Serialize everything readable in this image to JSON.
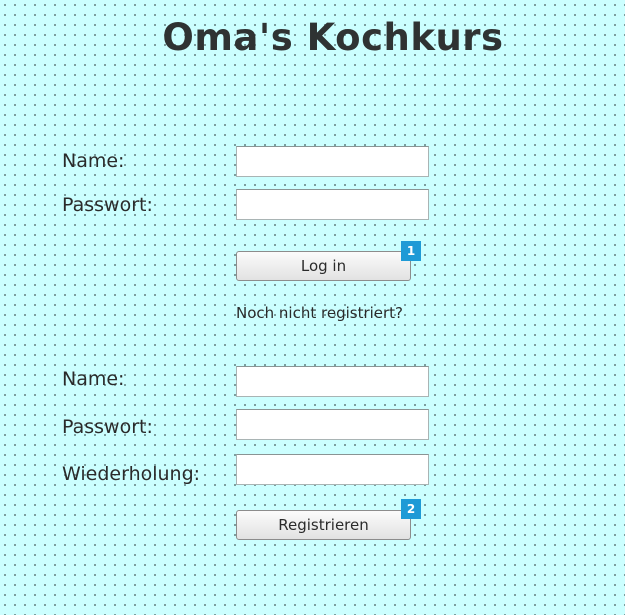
{
  "page": {
    "title": "Oma's Kochkurs"
  },
  "login": {
    "name_label": "Name:",
    "name_value": "",
    "password_label": "Passwort:",
    "password_value": "",
    "button_label": "Log in",
    "badge": "1"
  },
  "register_hint": "Noch nicht registriert?",
  "register": {
    "name_label": "Name:",
    "name_value": "",
    "password_label": "Passwort:",
    "password_value": "",
    "repeat_label": "Wiederholung:",
    "repeat_value": "",
    "button_label": "Registrieren",
    "badge": "2"
  },
  "colors": {
    "background": "#ccffff",
    "badge": "#1e9ad6",
    "text": "#2b2b2b"
  }
}
